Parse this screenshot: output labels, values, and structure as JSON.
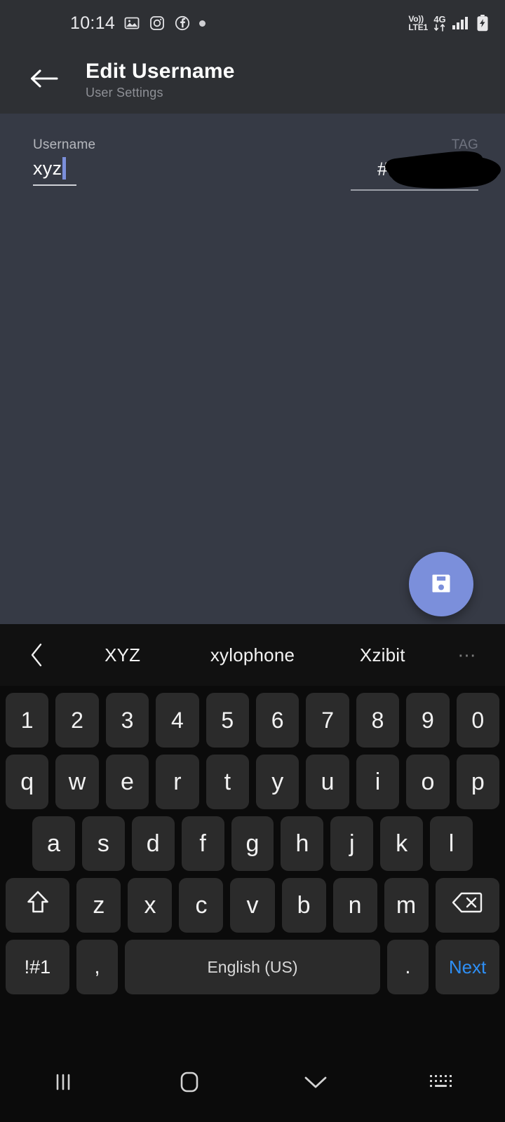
{
  "status_bar": {
    "time": "10:14",
    "icons": [
      "gallery-icon",
      "instagram-icon",
      "facebook-icon",
      "dot-icon"
    ],
    "volte_top": "Vo))",
    "volte_bottom": "LTE1",
    "network": "4G",
    "signal": "signal-bars-icon",
    "battery": "battery-charging-icon"
  },
  "app_bar": {
    "back": "back-arrow",
    "title": "Edit Username",
    "subtitle": "User Settings"
  },
  "form": {
    "username": {
      "label": "Username",
      "value": "xyz"
    },
    "tag": {
      "label": "TAG",
      "value": "",
      "redacted": true,
      "prefix": "#"
    }
  },
  "fab": {
    "icon": "save-icon",
    "color": "#7b8fdb"
  },
  "keyboard": {
    "suggestions": [
      "XYZ",
      "xylophone",
      "Xzibit"
    ],
    "prev_icon": "chevron-left-icon",
    "more_icon": "overflow-dots-icon",
    "rows": {
      "numbers": [
        "1",
        "2",
        "3",
        "4",
        "5",
        "6",
        "7",
        "8",
        "9",
        "0"
      ],
      "top": [
        "q",
        "w",
        "e",
        "r",
        "t",
        "y",
        "u",
        "i",
        "o",
        "p"
      ],
      "home": [
        "a",
        "s",
        "d",
        "f",
        "g",
        "h",
        "j",
        "k",
        "l"
      ],
      "bottom": [
        "z",
        "x",
        "c",
        "v",
        "b",
        "n",
        "m"
      ]
    },
    "shift": "shift-icon",
    "backspace": "backspace-icon",
    "symbols": "!#1",
    "comma": ",",
    "space": "English (US)",
    "period": ".",
    "action": "Next",
    "action_color": "#2e8ff5"
  },
  "nav_bar": {
    "recents": "recents-icon",
    "home": "home-icon",
    "hide_keyboard": "chevron-down-icon",
    "keyboard_switch": "keyboard-switch-icon"
  },
  "colors": {
    "body_bg": "#363a45",
    "appbar_bg": "#2e3034",
    "keyboard_bg": "#0b0b0b",
    "key_bg": "#2b2b2b",
    "accent": "#7b8fdb"
  }
}
